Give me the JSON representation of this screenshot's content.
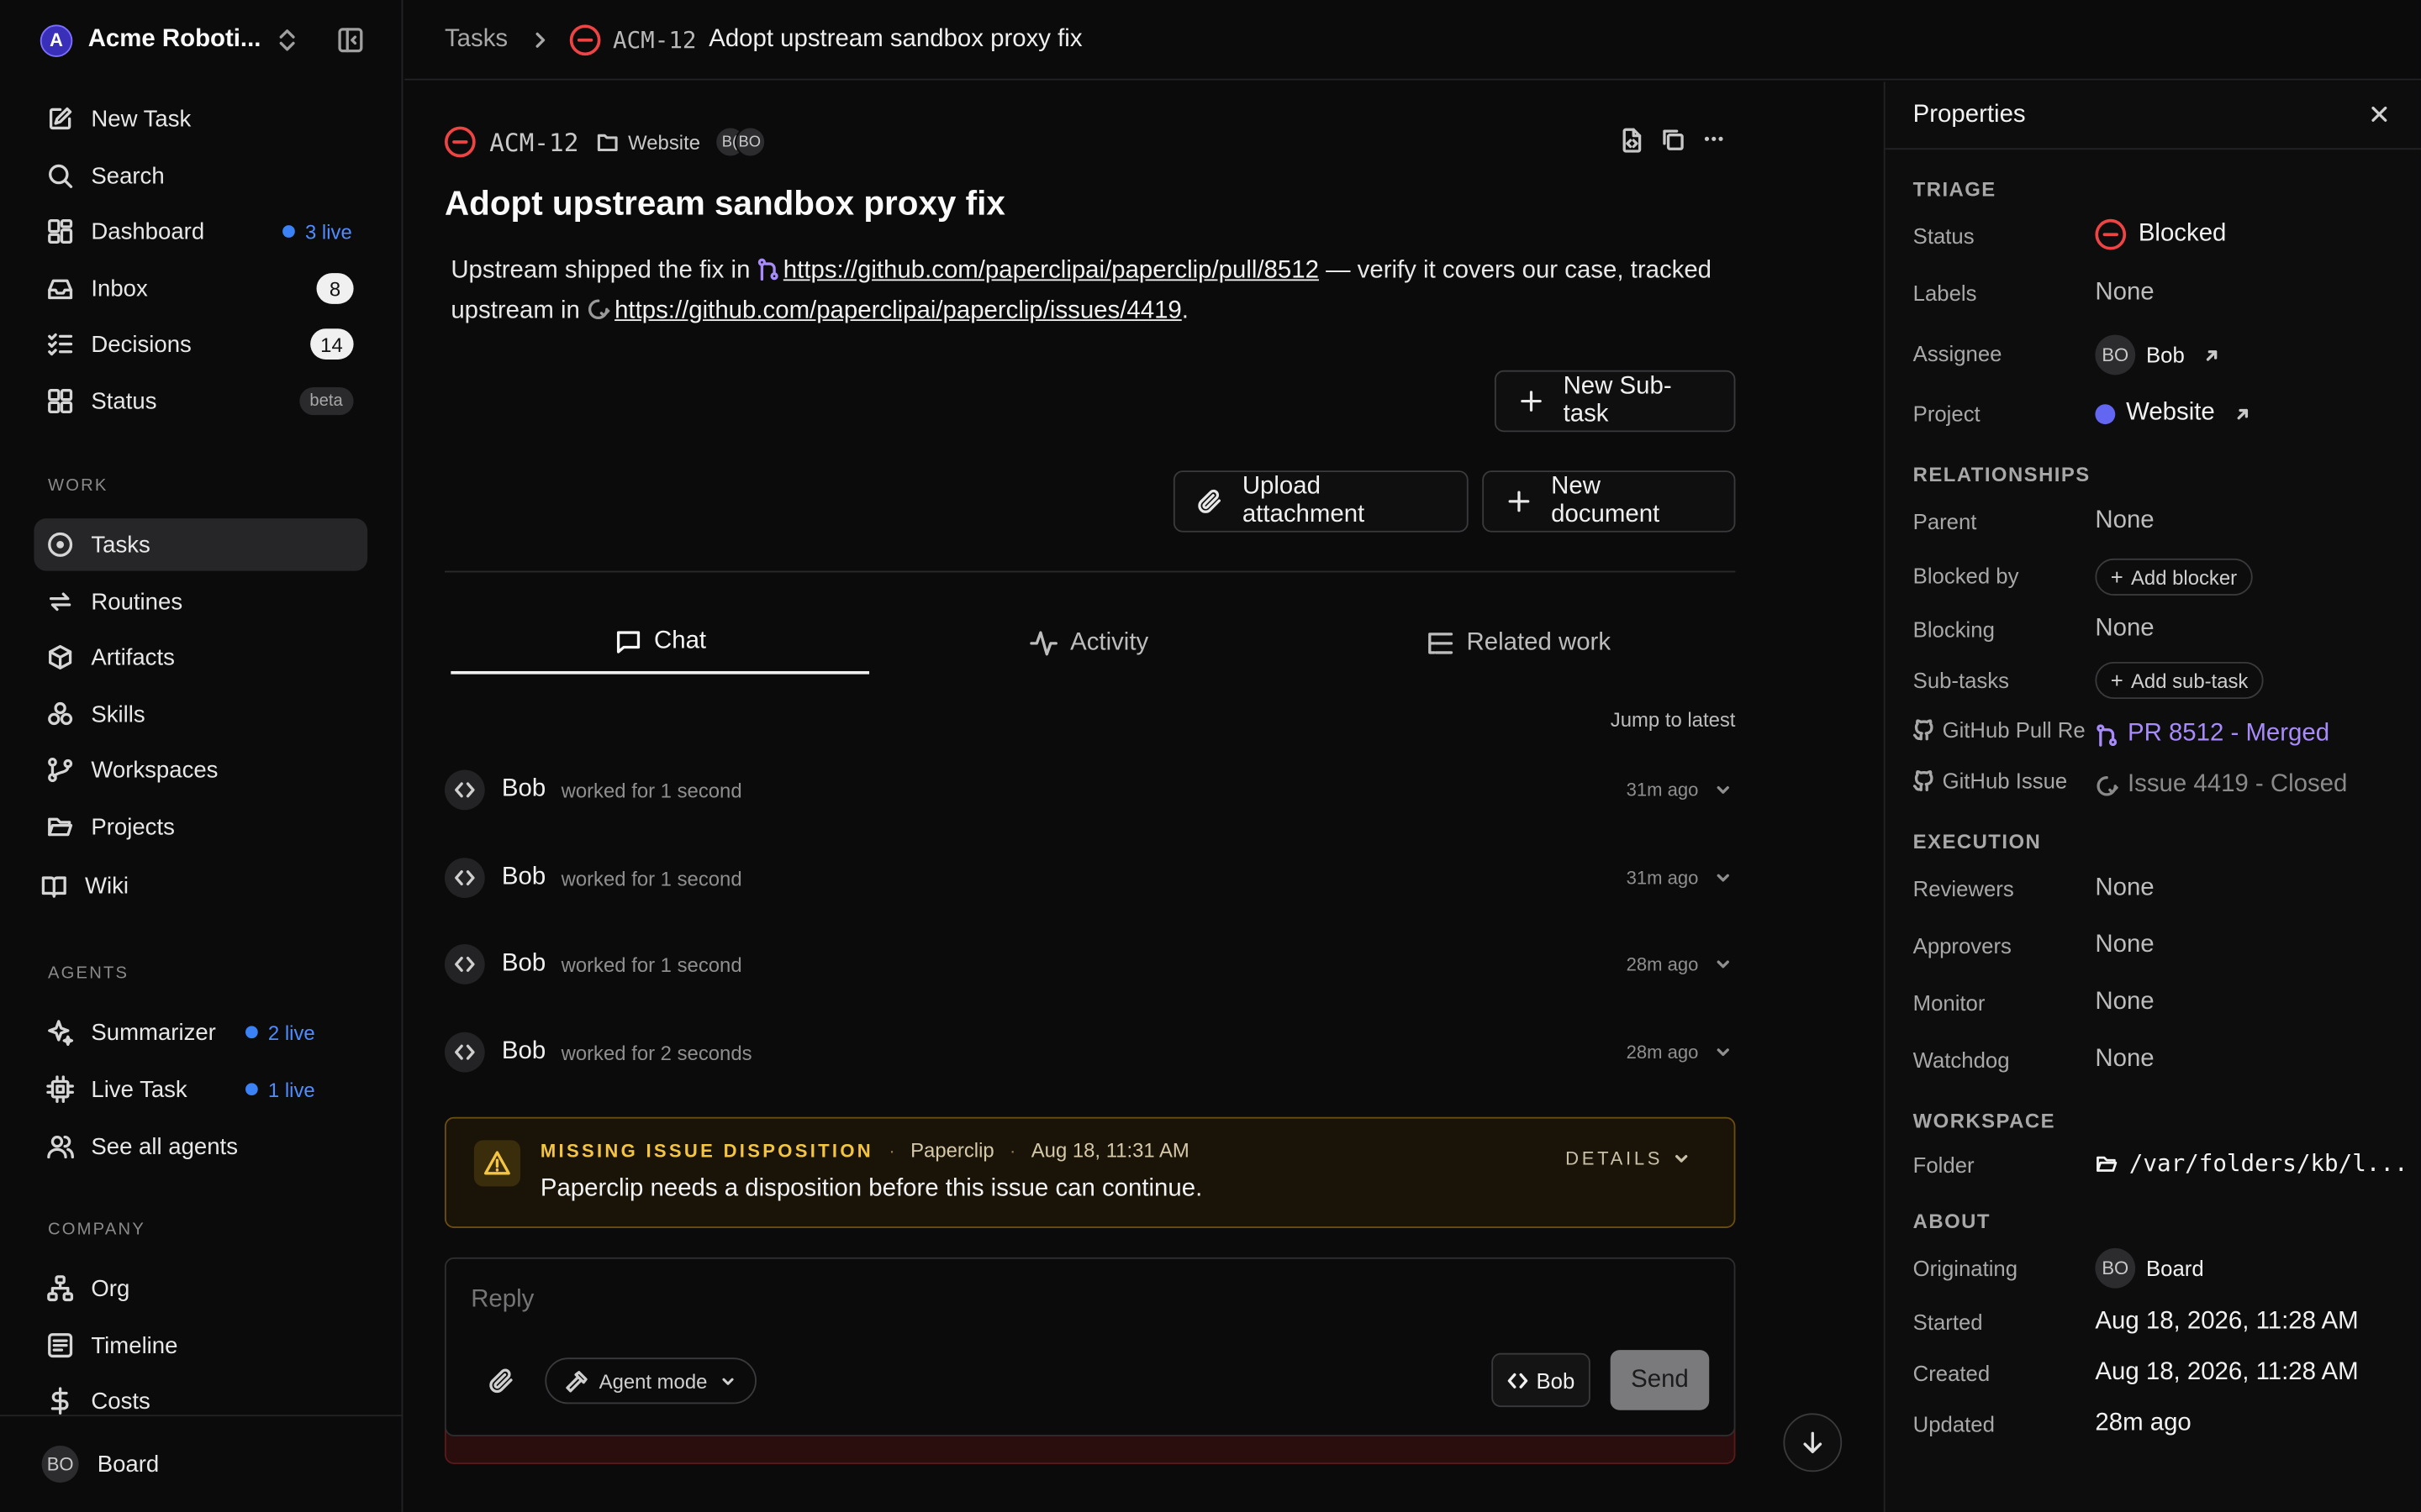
{
  "sidebar": {
    "org_initial": "A",
    "org_name": "Acme Roboti...",
    "top_items": [
      {
        "label": "New Task"
      },
      {
        "label": "Search"
      },
      {
        "label": "Dashboard",
        "live": "3 live"
      },
      {
        "label": "Inbox",
        "count": "8"
      },
      {
        "label": "Decisions",
        "count": "14"
      },
      {
        "label": "Status",
        "badge": "beta"
      }
    ],
    "work_label": "WORK",
    "work_items": [
      {
        "label": "Tasks"
      },
      {
        "label": "Routines"
      },
      {
        "label": "Artifacts"
      },
      {
        "label": "Skills"
      },
      {
        "label": "Workspaces"
      },
      {
        "label": "Projects"
      },
      {
        "label": "Wiki"
      }
    ],
    "agents_label": "AGENTS",
    "agent_items": [
      {
        "label": "Summarizer",
        "live": "2 live"
      },
      {
        "label": "Live Task",
        "live": "1 live"
      },
      {
        "label": "See all agents"
      }
    ],
    "company_label": "COMPANY",
    "company_items": [
      {
        "label": "Org"
      },
      {
        "label": "Timeline"
      },
      {
        "label": "Costs"
      }
    ],
    "footer": {
      "initials": "BO",
      "label": "Board"
    }
  },
  "header": {
    "root": "Tasks",
    "task_id": "ACM-12",
    "task_title": "Adopt upstream sandbox proxy fix"
  },
  "task": {
    "id": "ACM-12",
    "project": "Website",
    "avatars": [
      "B(",
      "BO"
    ],
    "title": "Adopt upstream sandbox proxy fix",
    "desc_part1": "Upstream shipped the fix in ",
    "pr_link": "https://github.com/paperclipai/paperclip/pull/8512",
    "desc_part2": " — verify it covers our case, tracked upstream in ",
    "issue_link": "https://github.com/paperclipai/paperclip/issues/4419",
    "desc_part3": ".",
    "new_subtask": "New Sub-task",
    "upload_attachment": "Upload attachment",
    "new_document": "New document"
  },
  "tabs": [
    {
      "label": "Chat"
    },
    {
      "label": "Activity"
    },
    {
      "label": "Related work"
    }
  ],
  "jump_to_latest": "Jump to latest",
  "runs": [
    {
      "who": "Bob",
      "what": "worked for 1 second",
      "when": "31m ago"
    },
    {
      "who": "Bob",
      "what": "worked for 1 second",
      "when": "31m ago"
    },
    {
      "who": "Bob",
      "what": "worked for 1 second",
      "when": "28m ago"
    },
    {
      "who": "Bob",
      "what": "worked for 2 seconds",
      "when": "28m ago"
    }
  ],
  "warning": {
    "tag": "MISSING ISSUE DISPOSITION",
    "source": "Paperclip",
    "time": "Aug 18, 11:31 AM",
    "message": "Paperclip needs a disposition before this issue can continue.",
    "details": "DETAILS"
  },
  "composer": {
    "placeholder": "Reply",
    "mode": "Agent mode",
    "agent": "Bob",
    "send": "Send"
  },
  "properties": {
    "title": "Properties",
    "triage": "TRIAGE",
    "status_label": "Status",
    "status_value": "Blocked",
    "labels_label": "Labels",
    "labels_value": "None",
    "assignee_label": "Assignee",
    "assignee_initials": "BO",
    "assignee_value": "Bob",
    "project_label": "Project",
    "project_value": "Website",
    "project_color": "#6366f1",
    "relationships": "RELATIONSHIPS",
    "parent_label": "Parent",
    "parent_value": "None",
    "blocked_by_label": "Blocked by",
    "add_blocker": "Add blocker",
    "blocking_label": "Blocking",
    "blocking_value": "None",
    "subtasks_label": "Sub-tasks",
    "add_subtask": "Add sub-task",
    "gh_pr_label": "GitHub Pull Re",
    "gh_pr_value": "PR 8512 - Merged",
    "gh_issue_label": "GitHub Issue",
    "gh_issue_value": "Issue 4419 - Closed",
    "execution": "EXECUTION",
    "reviewers_label": "Reviewers",
    "reviewers_value": "None",
    "approvers_label": "Approvers",
    "approvers_value": "None",
    "monitor_label": "Monitor",
    "monitor_value": "None",
    "watchdog_label": "Watchdog",
    "watchdog_value": "None",
    "workspace": "WORKSPACE",
    "folder_label": "Folder",
    "folder_value": "/var/folders/kb/l...",
    "about": "ABOUT",
    "originating_label": "Originating",
    "originating_initials": "BO",
    "originating_value": "Board",
    "started_label": "Started",
    "started_value": "Aug 18, 2026, 11:28 AM",
    "created_label": "Created",
    "created_value": "Aug 18, 2026, 11:28 AM",
    "updated_label": "Updated",
    "updated_value": "28m ago"
  },
  "colors": {
    "blocked": "#ef4444",
    "live": "#3b82f6",
    "pr_merged": "#a78bfa",
    "warning": "#f5c542"
  }
}
